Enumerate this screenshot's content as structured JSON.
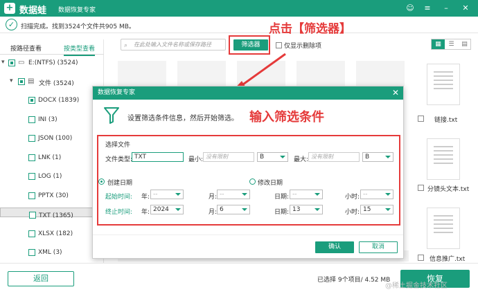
{
  "app": {
    "logo_glyph": "+",
    "name": "数据蛙",
    "subtitle": "数据恢复专家",
    "controls": [
      "☺",
      "≡",
      "–",
      "✕"
    ]
  },
  "status": {
    "text": "扫描完成。找到3524个文件共905 MB。"
  },
  "left_tabs": {
    "by_path": "按路径查看",
    "by_type": "按类型查看"
  },
  "tree": {
    "drive": "E:(NTFS) (3524)",
    "folder": "文件 (3524)",
    "types": [
      {
        "label": "DOCX (1839)",
        "checked": true
      },
      {
        "label": "INI (3)",
        "checked": false
      },
      {
        "label": "JSON (100)",
        "checked": false
      },
      {
        "label": "LNK (1)",
        "checked": false
      },
      {
        "label": "LOG (1)",
        "checked": false
      },
      {
        "label": "PPTX (30)",
        "checked": false
      },
      {
        "label": "TXT (1365)",
        "checked": false,
        "selected": true
      },
      {
        "label": "XLSX (182)",
        "checked": false
      },
      {
        "label": "XML (3)",
        "checked": false
      }
    ]
  },
  "toolbar": {
    "search_placeholder": "在此处输入文件名称或保存路径",
    "filter_button": "筛选器",
    "only_deleted": "仅显示删除项",
    "view_icons": [
      "▦",
      "☰",
      "▤"
    ]
  },
  "right_files": {
    "names": [
      "链接.txt",
      "分镜头文本.txt",
      "信息推广.txt"
    ]
  },
  "annotations": {
    "click_filter": "点击【筛选器】",
    "input_conditions": "输入筛选条件"
  },
  "dialog": {
    "title": "数据恢复专家",
    "close": "✕",
    "hint": "设置筛选条件信息，然后开始筛选。",
    "section": "选择文件",
    "file_type_label": "文件类型:",
    "file_type_value": "TXT",
    "min_label": "最小:",
    "min_placeholder": "没有限制",
    "min_unit": "B",
    "max_label": "最大:",
    "max_placeholder": "没有限制",
    "max_unit": "B",
    "created_date": "创建日期",
    "modified_date": "修改日期",
    "start_label": "起始时间:",
    "end_label": "终止时间:",
    "year": "年:",
    "month": "月:",
    "day": "日期:",
    "hour": "小时:",
    "start": {
      "year": "--",
      "month": "--",
      "day": "--",
      "hour": "--"
    },
    "end": {
      "year": "2024",
      "month": "6",
      "day": "13",
      "hour": "15"
    },
    "ok": "确认",
    "cancel": "取消"
  },
  "footer": {
    "back": "返回",
    "selection_info": "已选择 9个项目/ 4.52 MB",
    "recover": "恢复",
    "watermark": "@稀土掘金技术社区"
  },
  "colors": {
    "accent": "#1a9d7c",
    "annotation_red": "#e53a3a"
  }
}
